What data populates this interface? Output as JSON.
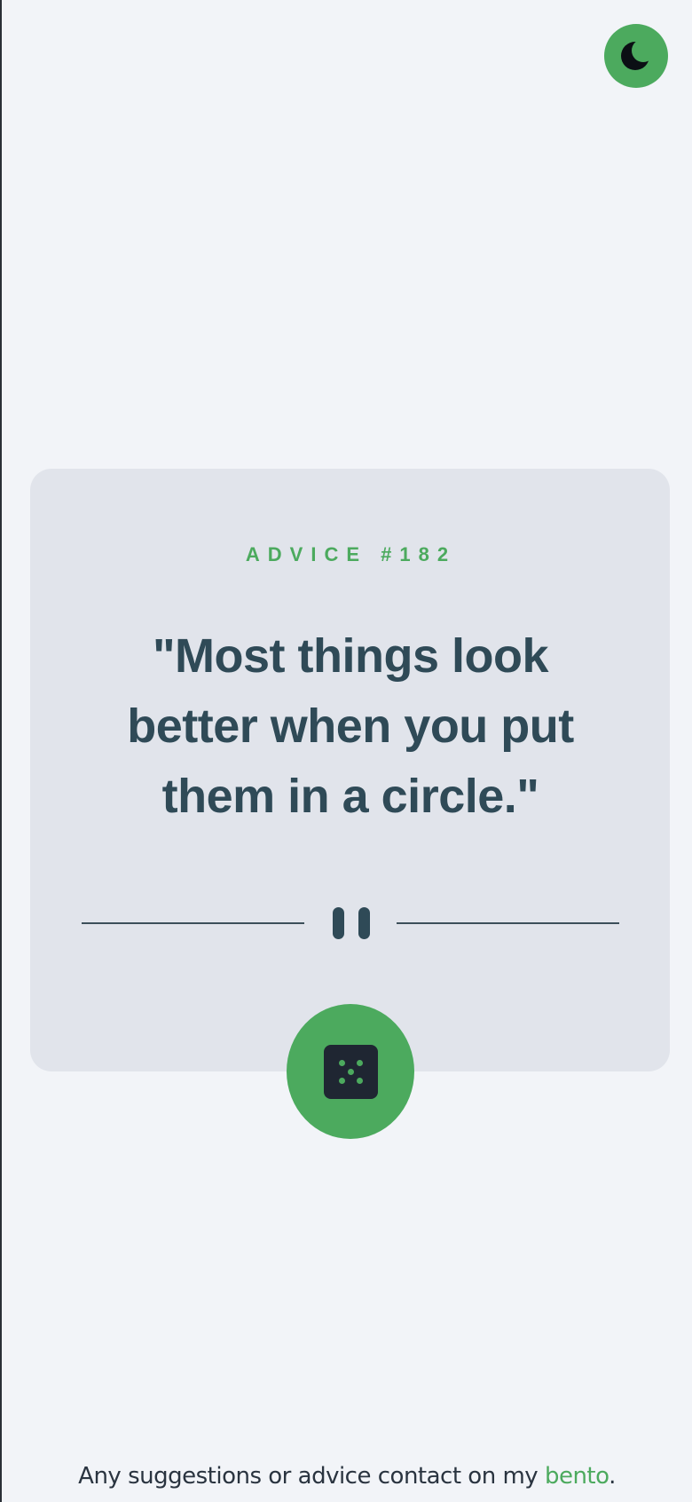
{
  "theme_toggle": {
    "icon": "moon-icon"
  },
  "card": {
    "label": "ADVICE #182",
    "advice": "\"Most things look better when you put them in a circle.\""
  },
  "divider": {
    "icon": "pause-icon"
  },
  "dice_button": {
    "icon": "dice-icon"
  },
  "footer": {
    "text_before": "Any suggestions or advice contact on my ",
    "link_text": "bento",
    "text_after": "."
  },
  "colors": {
    "accent": "#4caa5e",
    "background": "#f2f4f8",
    "card": "#e1e4eb",
    "text": "#2f4a57"
  }
}
